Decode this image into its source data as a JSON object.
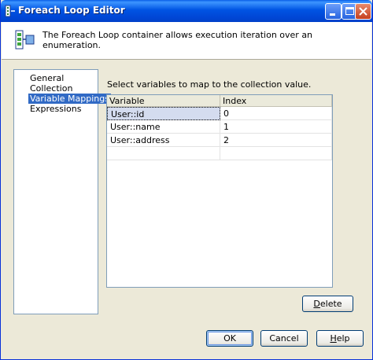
{
  "window": {
    "title": "Foreach Loop Editor"
  },
  "header": {
    "description": "The Foreach Loop container allows execution iteration over an enumeration."
  },
  "nav": {
    "items": [
      {
        "label": "General",
        "selected": false
      },
      {
        "label": "Collection",
        "selected": false
      },
      {
        "label": "Variable Mappings",
        "selected": true
      },
      {
        "label": "Expressions",
        "selected": false
      }
    ]
  },
  "mapping": {
    "prompt": "Select variables to map to the collection value.",
    "columns": [
      "Variable",
      "Index"
    ],
    "rows": [
      {
        "variable": "User::id",
        "index": "0"
      },
      {
        "variable": "User::name",
        "index": "1"
      },
      {
        "variable": "User::address",
        "index": "2"
      }
    ]
  },
  "buttons": {
    "delete": {
      "pre": "",
      "accel": "D",
      "post": "elete"
    },
    "ok": "OK",
    "cancel": "Cancel",
    "help": {
      "pre": "",
      "accel": "H",
      "post": "elp"
    }
  },
  "colors": {
    "titlebar": "#0054e3",
    "selection": "#316ac5",
    "dialog_bg": "#ece9d8"
  },
  "icons": {
    "title": "foreach-loop-icon",
    "header": "foreach-loop-container-icon"
  }
}
